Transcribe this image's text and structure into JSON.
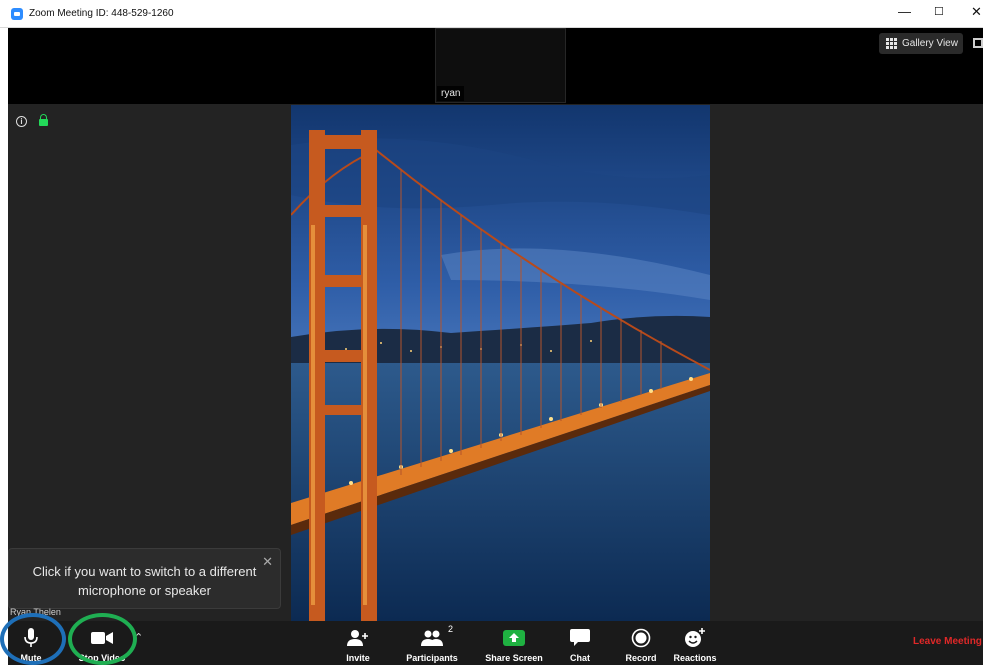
{
  "window": {
    "title": "Zoom Meeting ID: 448-529-1260",
    "controls": {
      "minimize": "—",
      "maximize": "☐",
      "close": "✕"
    }
  },
  "top_strip": {
    "thumbnail_name": "ryan",
    "gallery_view_label": "Gallery View"
  },
  "notification": {
    "text_line1": "Click if you want to switch to a different",
    "text_line2": "microphone or speaker",
    "close": "✕"
  },
  "participant_name": "Ryan Thelen",
  "toolbar": {
    "mute": "Mute",
    "stop_video": "Stop Video",
    "invite": "Invite",
    "participants": "Participants",
    "participants_count": "2",
    "share_screen": "Share Screen",
    "chat": "Chat",
    "record": "Record",
    "reactions": "Reactions",
    "leave": "Leave Meeting"
  },
  "colors": {
    "accent_green": "#23d959",
    "share_green": "#1fb141",
    "leave_red": "#e02828",
    "mute_ring": "#1e6fb8",
    "video_ring": "#1fae52"
  },
  "icons": [
    "zoom-app-icon",
    "grid-icon",
    "fullscreen-icon",
    "info-icon",
    "lock-icon",
    "microphone-icon",
    "video-camera-icon",
    "caret-icon",
    "add-person-icon",
    "participants-icon",
    "share-screen-icon",
    "chat-icon",
    "record-icon",
    "reactions-icon",
    "close-icon"
  ]
}
